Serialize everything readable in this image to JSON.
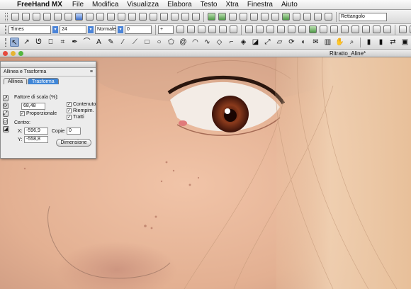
{
  "menubar": {
    "app_name": "FreeHand MX",
    "items": [
      "File",
      "Modifica",
      "Visualizza",
      "Elabora",
      "Testo",
      "Xtra",
      "Finestra",
      "Aiuto"
    ]
  },
  "toolbar": {
    "object_type": "Rettangolo",
    "font_name": "Times",
    "font_size": "24",
    "font_style": "Normale",
    "tracking": "0",
    "stepper_plus": "+"
  },
  "document": {
    "title": "Ritratto_Aline*"
  },
  "panel": {
    "title": "Allinea e Trasforma",
    "tabs": [
      "Allinea",
      "Trasforma"
    ],
    "scale_label": "Fattore di scala (%):",
    "scale_value": "68,48",
    "proportional_label": "Proporzionale",
    "content_label": "Contenuto",
    "fill_label": "Riempim.",
    "strokes_label": "Tratti",
    "center_label": "Centro:",
    "x_label": "X:",
    "x_value": "-596,9",
    "y_label": "Y:",
    "y_value": "-558,8",
    "copies_label": "Copie",
    "copies_value": "0",
    "dimension_button": "Dimensione"
  }
}
